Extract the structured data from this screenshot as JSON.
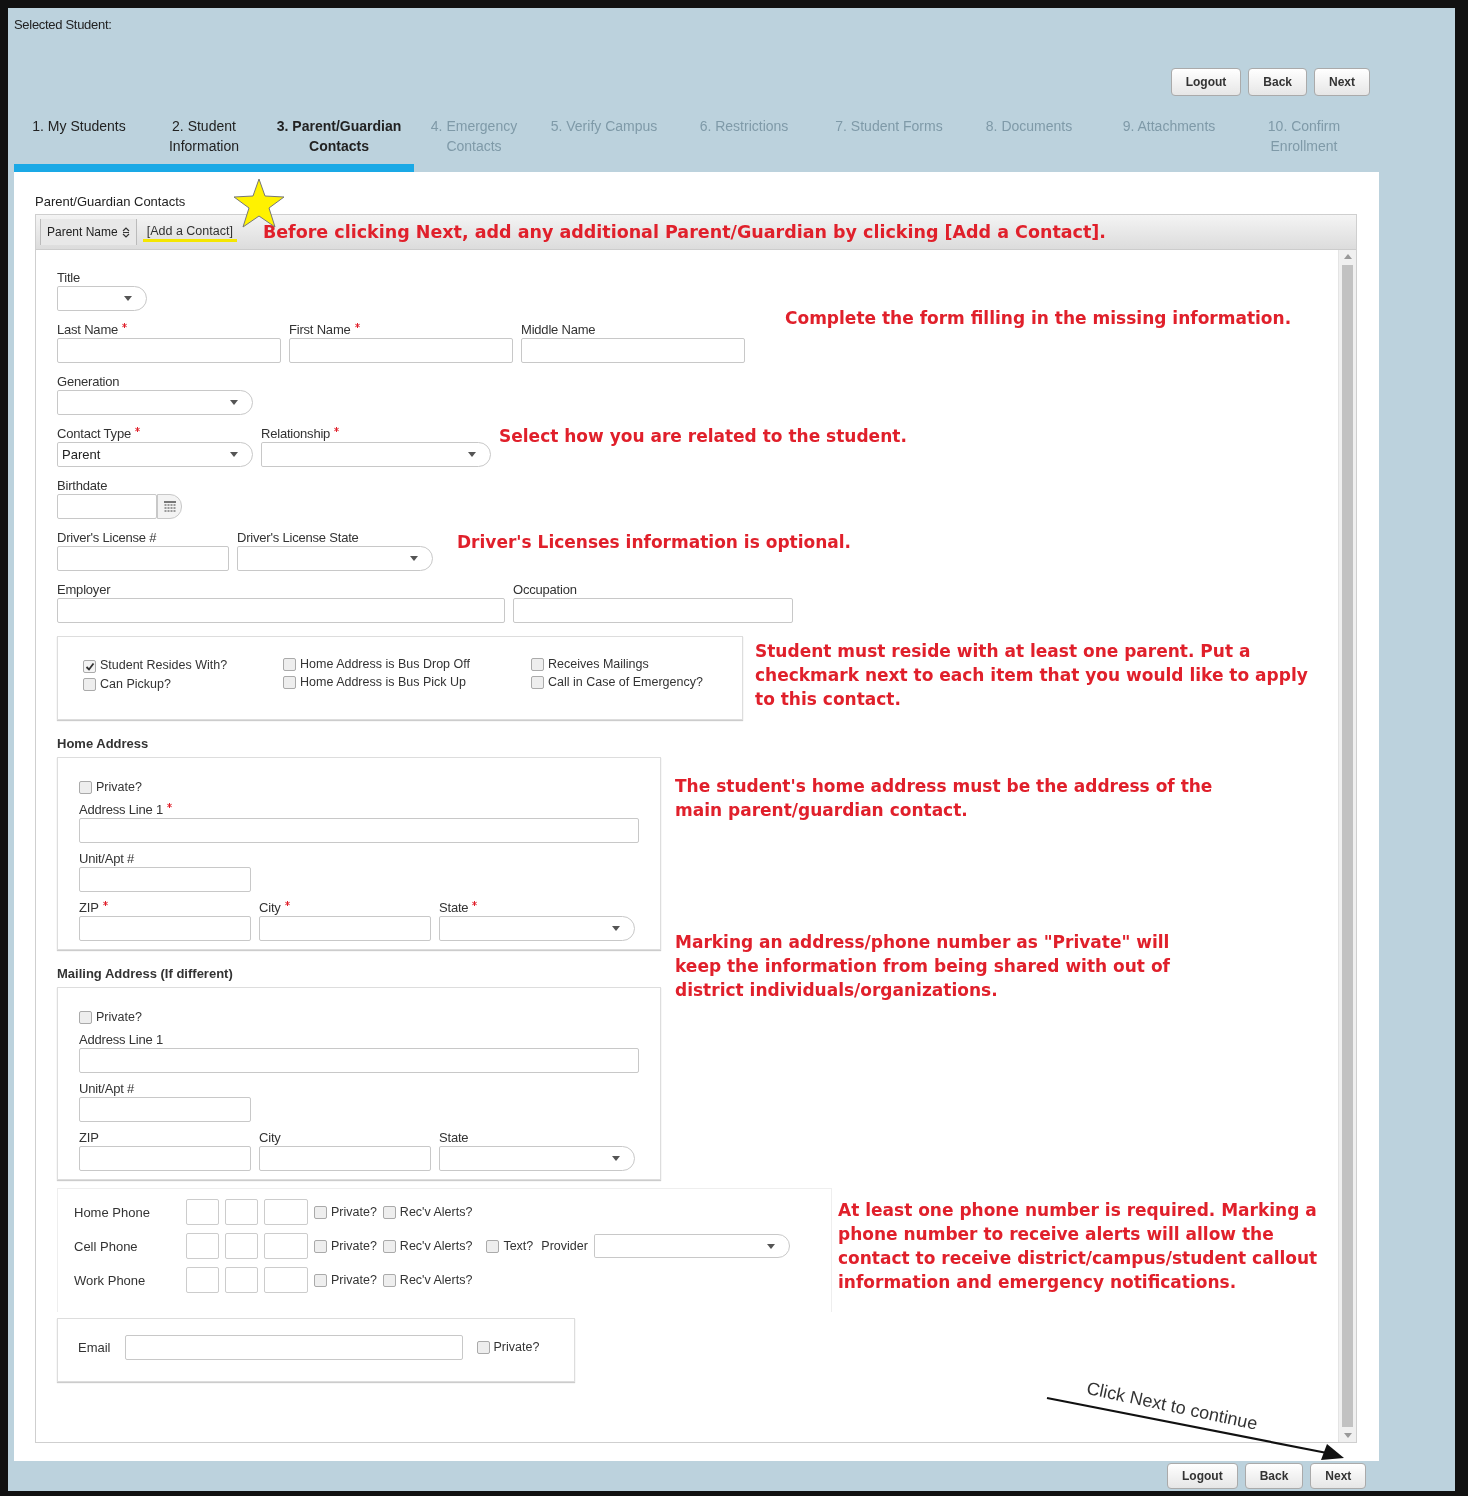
{
  "header": {
    "selected_student_label": "Selected Student:"
  },
  "top_buttons": [
    "Logout",
    "Back",
    "Next"
  ],
  "steps": [
    {
      "label": "1. My Students",
      "enabled": true,
      "selected": false
    },
    {
      "label": "2. Student Information",
      "enabled": true,
      "selected": false
    },
    {
      "label": "3. Parent/Guardian Contacts",
      "enabled": true,
      "selected": true
    },
    {
      "label": "4. Emergency Contacts",
      "enabled": false,
      "selected": false
    },
    {
      "label": "5. Verify Campus",
      "enabled": false,
      "selected": false
    },
    {
      "label": "6. Restrictions",
      "enabled": false,
      "selected": false
    },
    {
      "label": "7. Student Forms",
      "enabled": false,
      "selected": false
    },
    {
      "label": "8. Documents",
      "enabled": false,
      "selected": false
    },
    {
      "label": "9. Attachments",
      "enabled": false,
      "selected": false
    },
    {
      "label": "10. Confirm Enrollment",
      "enabled": false,
      "selected": false
    }
  ],
  "section_title": "Parent/Guardian Contacts",
  "list_header": {
    "column": "Parent Name",
    "add_link": "[Add a Contact]",
    "note": "Before clicking Next, add any additional Parent/Guardian by clicking [Add a Contact]."
  },
  "form_rows": [
    {
      "fields": [
        {
          "label": "Title",
          "required": false,
          "kind": "select"
        }
      ]
    },
    {
      "fields": [
        {
          "label": "Last Name",
          "required": true,
          "kind": "text"
        },
        {
          "label": "First Name",
          "required": true,
          "kind": "text"
        },
        {
          "label": "Middle Name",
          "required": false,
          "kind": "text"
        }
      ],
      "note": "Complete the form filling in the missing information."
    },
    {
      "fields": [
        {
          "label": "Generation",
          "required": false,
          "kind": "select"
        }
      ]
    },
    {
      "fields": [
        {
          "label": "Contact Type",
          "required": true,
          "kind": "select",
          "value": "Parent"
        },
        {
          "label": "Relationship",
          "required": true,
          "kind": "select"
        }
      ],
      "note": "Select how you are related to the student."
    },
    {
      "fields": [
        {
          "label": "Birthdate",
          "required": false,
          "kind": "date"
        }
      ]
    },
    {
      "fields": [
        {
          "label": "Driver's License #",
          "required": false,
          "kind": "text"
        },
        {
          "label": "Driver's License State",
          "required": false,
          "kind": "select"
        }
      ],
      "note": "Driver's Licenses information is optional."
    },
    {
      "fields": [
        {
          "label": "Employer",
          "required": false,
          "kind": "text"
        },
        {
          "label": "Occupation",
          "required": false,
          "kind": "text"
        }
      ]
    }
  ],
  "options": {
    "columns": [
      [
        {
          "label": "Student Resides With?",
          "checked": true
        },
        {
          "label": "Can Pickup?",
          "checked": false
        }
      ],
      [
        {
          "label": "Home Address is Bus Drop Off",
          "checked": false
        },
        {
          "label": "Home Address is Bus Pick Up",
          "checked": false
        }
      ],
      [
        {
          "label": "Receives Mailings",
          "checked": false
        },
        {
          "label": "Call in Case of Emergency?",
          "checked": false
        }
      ]
    ],
    "note": "Student must reside with at least one parent. Put a checkmark next to each item that you would like to apply to this contact."
  },
  "addresses": [
    {
      "heading": "Home Address",
      "private": {
        "label": "Private?",
        "checked": false
      },
      "line1": {
        "label": "Address Line 1",
        "required": true
      },
      "unit": {
        "label": "Unit/Apt #",
        "required": false
      },
      "zip": {
        "label": "ZIP",
        "required": true
      },
      "city": {
        "label": "City",
        "required": true
      },
      "state": {
        "label": "State",
        "required": true
      },
      "note": "The student's home address must be the address of the main parent/guardian contact."
    },
    {
      "heading": "Mailing Address (If different)",
      "private": {
        "label": "Private?",
        "checked": false
      },
      "line1": {
        "label": "Address Line 1",
        "required": false
      },
      "unit": {
        "label": "Unit/Apt #",
        "required": false
      },
      "zip": {
        "label": "ZIP",
        "required": false
      },
      "city": {
        "label": "City",
        "required": false
      },
      "state": {
        "label": "State",
        "required": false
      },
      "note": "Marking an address/phone number as \"Private\" will keep the information from being shared with out of district individuals/organizations."
    }
  ],
  "phones": {
    "rows": [
      {
        "kind": "basic",
        "label": "Home Phone",
        "private": {
          "label": "Private?",
          "checked": false
        },
        "alerts": {
          "label": "Rec'v Alerts?",
          "checked": false
        }
      },
      {
        "kind": "cell",
        "label": "Cell Phone",
        "private": {
          "label": "Private?",
          "checked": false
        },
        "alerts": {
          "label": "Rec'v Alerts?",
          "checked": false
        },
        "text": {
          "label": "Text?",
          "checked": false
        },
        "provider_label": "Provider"
      },
      {
        "kind": "basic",
        "label": "Work Phone",
        "private": {
          "label": "Private?",
          "checked": false
        },
        "alerts": {
          "label": "Rec'v Alerts?",
          "checked": false
        }
      }
    ],
    "note": "At least one phone number is required. Marking a phone number to receive alerts will allow the contact to receive district/campus/student callout information and emergency notifications."
  },
  "email": {
    "label": "Email",
    "private": {
      "label": "Private?",
      "checked": false
    }
  },
  "next_hint": "Click Next to continue",
  "bottom_buttons": [
    "Logout",
    "Back",
    "Next"
  ]
}
